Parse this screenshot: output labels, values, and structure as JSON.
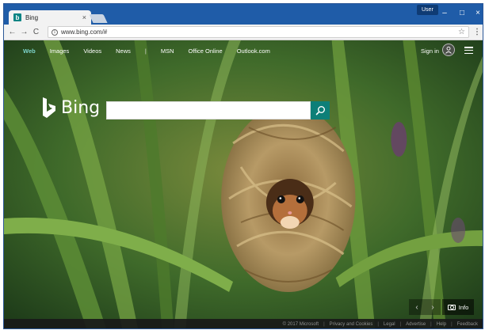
{
  "browser": {
    "tab_title": "Bing",
    "tab_favicon": "b",
    "tab_close": "×",
    "user_label": "User",
    "window_min": "–",
    "window_max": "□",
    "window_close": "×",
    "url": "www.bing.com/#",
    "back_icon": "←",
    "forward_icon": "→",
    "reload_icon": "C",
    "info_icon": "i",
    "star_icon": "☆",
    "menu_icon": "⋮"
  },
  "nav": {
    "items": [
      "Web",
      "Images",
      "Videos",
      "News",
      "MSN",
      "Office Online",
      "Outlook.com"
    ],
    "divider": "|",
    "sign_in": "Sign in"
  },
  "logo": {
    "text": "Bing"
  },
  "search": {
    "placeholder": ""
  },
  "carousel": {
    "prev": "‹",
    "next": "›",
    "info_label": "Info"
  },
  "footer": {
    "items": [
      "© 2017 Microsoft",
      "Privacy and Cookies",
      "Legal",
      "Advertise",
      "Help",
      "Feedback"
    ]
  },
  "colors": {
    "titlebar": "#1f5ca8",
    "accent": "#0d7f78",
    "nav_active": "#7dd3c9"
  }
}
